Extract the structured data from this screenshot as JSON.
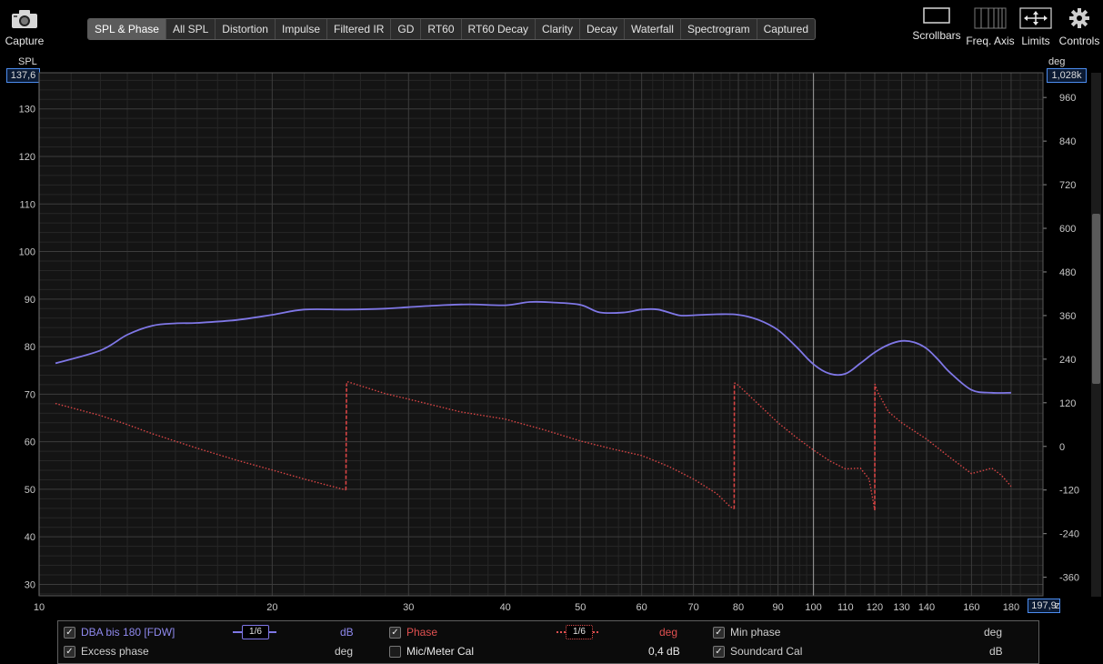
{
  "toolbar": {
    "capture_label": "Capture",
    "tabs": [
      "SPL & Phase",
      "All SPL",
      "Distortion",
      "Impulse",
      "Filtered IR",
      "GD",
      "RT60",
      "RT60 Decay",
      "Clarity",
      "Decay",
      "Waterfall",
      "Spectrogram",
      "Captured"
    ],
    "active_tab": "SPL & Phase",
    "right_tools": [
      "Scrollbars",
      "Freq. Axis",
      "Limits",
      "Controls"
    ]
  },
  "axes": {
    "left_title": "SPL",
    "right_title": "deg",
    "left_top_value": "137,6",
    "right_top_value": "1,028k",
    "x_right_value": "197,9",
    "x_unit_suffix": "z"
  },
  "chart_data": {
    "type": "line",
    "x_scale": "log",
    "xlim": [
      10,
      197.9
    ],
    "ylim_left": [
      27.6,
      137.6
    ],
    "ylim_right": [
      -411,
      1028
    ],
    "x_ticks": [
      10,
      20,
      30,
      40,
      50,
      60,
      70,
      80,
      90,
      100,
      110,
      120,
      130,
      140,
      160,
      180
    ],
    "y_left_ticks": [
      30,
      40,
      50,
      60,
      70,
      80,
      90,
      100,
      110,
      120,
      130
    ],
    "y_right_ticks": [
      960,
      840,
      720,
      600,
      480,
      360,
      240,
      120,
      0,
      -120,
      -240,
      -360
    ],
    "grid": true,
    "series": [
      {
        "name": "DBA bis 180 [FDW]",
        "axis": "left",
        "unit": "dB",
        "color": "#7f77e6",
        "smoothing": "1/6",
        "x": [
          10.5,
          12,
          13,
          14,
          15,
          16,
          18,
          20,
          22,
          25,
          28,
          30,
          33,
          36,
          40,
          43,
          46,
          50,
          53,
          57,
          60,
          63,
          67,
          70,
          75,
          80,
          85,
          90,
          95,
          100,
          105,
          110,
          115,
          120,
          125,
          130,
          135,
          140,
          145,
          150,
          160,
          170,
          180
        ],
        "y": [
          76.5,
          79.2,
          82.5,
          84.4,
          84.9,
          85,
          85.6,
          86.7,
          87.8,
          87.8,
          88,
          88.3,
          88.7,
          88.9,
          88.7,
          89.4,
          89.3,
          88.8,
          87.2,
          87.2,
          87.8,
          87.8,
          86.6,
          86.6,
          86.8,
          86.7,
          85.6,
          83.5,
          80,
          76.3,
          74.3,
          74.3,
          76.5,
          78.8,
          80.4,
          81.2,
          80.9,
          79.6,
          77.2,
          74.6,
          70.9,
          70.3,
          70.3
        ]
      },
      {
        "name": "Phase",
        "axis": "right",
        "unit": "deg",
        "color": "#d94545",
        "smoothing": "1/6",
        "x": [
          10.5,
          12,
          13,
          14,
          16,
          18,
          20,
          22,
          24.9,
          24.95,
          25,
          28,
          30,
          35,
          40,
          45,
          50,
          55,
          60,
          65,
          70,
          75,
          78,
          79,
          79.05,
          80,
          85,
          90,
          95,
          100,
          105,
          110,
          115,
          118,
          120,
          120.05,
          121,
          125,
          130,
          140,
          150,
          160,
          170,
          175,
          180
        ],
        "y": [
          118,
          85,
          60,
          35,
          -5,
          -38,
          -65,
          -90,
          -120,
          170,
          178,
          145,
          130,
          95,
          75,
          45,
          15,
          -7,
          -25,
          -55,
          -90,
          -130,
          -165,
          -172,
          175,
          168,
          115,
          65,
          25,
          -10,
          -40,
          -62,
          -60,
          -90,
          -175,
          172,
          150,
          95,
          65,
          20,
          -30,
          -75,
          -60,
          -80,
          -110
        ]
      }
    ]
  },
  "legend": {
    "rows": [
      [
        {
          "label": "DBA bis 180 [FDW]",
          "checked": true,
          "color": "#7f77e6",
          "smoothing": "1/6",
          "unit": "dB"
        },
        {
          "label": "Phase",
          "checked": true,
          "color": "#e05050",
          "smoothing": "1/6",
          "unit": "deg"
        },
        {
          "label": "Min phase",
          "checked": true,
          "color": "#cfcfcf",
          "unit": "deg"
        }
      ],
      [
        {
          "label": "Excess phase",
          "checked": true,
          "color": "#cfcfcf",
          "unit": "deg"
        },
        {
          "label": "Mic/Meter Cal",
          "checked": false,
          "color": "#e8e8e8",
          "value": "0,4 dB"
        },
        {
          "label": "Soundcard Cal",
          "checked": true,
          "color": "#cfcfcf",
          "unit": "dB"
        }
      ]
    ]
  }
}
